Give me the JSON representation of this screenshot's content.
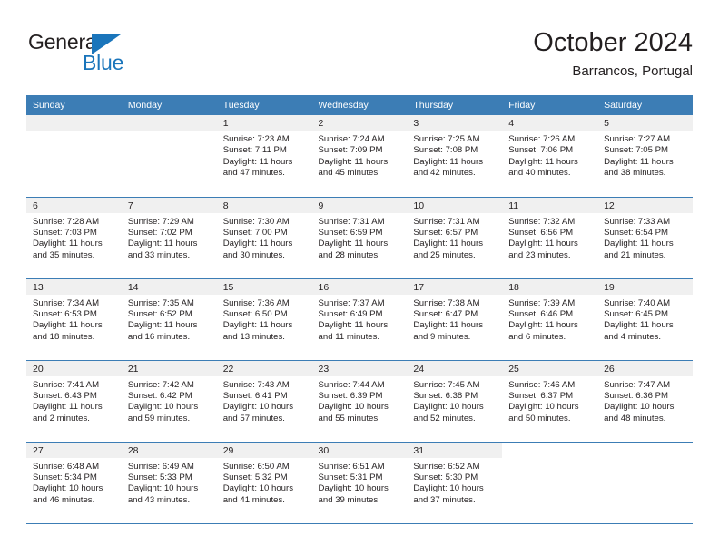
{
  "brand": {
    "name_top": "General",
    "name_bottom": "Blue",
    "mark": "blue-triangle-icon",
    "accent_color": "#1a75bb"
  },
  "header": {
    "title": "October 2024",
    "subtitle": "Barrancos, Portugal"
  },
  "theme": {
    "header_row_color": "#3c7db5",
    "daynum_band_color": "#f0f0f0",
    "text_color": "#231f20"
  },
  "weekdays": [
    "Sunday",
    "Monday",
    "Tuesday",
    "Wednesday",
    "Thursday",
    "Friday",
    "Saturday"
  ],
  "labels": {
    "sunrise_prefix": "Sunrise:",
    "sunset_prefix": "Sunset:",
    "daylight_prefix": "Daylight:"
  },
  "weeks": [
    [
      {
        "day": "",
        "sunrise": "",
        "sunset": "",
        "daylight_line1": "",
        "daylight_line2": ""
      },
      {
        "day": "",
        "sunrise": "",
        "sunset": "",
        "daylight_line1": "",
        "daylight_line2": ""
      },
      {
        "day": "1",
        "sunrise": "Sunrise: 7:23 AM",
        "sunset": "Sunset: 7:11 PM",
        "daylight_line1": "Daylight: 11 hours",
        "daylight_line2": "and 47 minutes."
      },
      {
        "day": "2",
        "sunrise": "Sunrise: 7:24 AM",
        "sunset": "Sunset: 7:09 PM",
        "daylight_line1": "Daylight: 11 hours",
        "daylight_line2": "and 45 minutes."
      },
      {
        "day": "3",
        "sunrise": "Sunrise: 7:25 AM",
        "sunset": "Sunset: 7:08 PM",
        "daylight_line1": "Daylight: 11 hours",
        "daylight_line2": "and 42 minutes."
      },
      {
        "day": "4",
        "sunrise": "Sunrise: 7:26 AM",
        "sunset": "Sunset: 7:06 PM",
        "daylight_line1": "Daylight: 11 hours",
        "daylight_line2": "and 40 minutes."
      },
      {
        "day": "5",
        "sunrise": "Sunrise: 7:27 AM",
        "sunset": "Sunset: 7:05 PM",
        "daylight_line1": "Daylight: 11 hours",
        "daylight_line2": "and 38 minutes."
      }
    ],
    [
      {
        "day": "6",
        "sunrise": "Sunrise: 7:28 AM",
        "sunset": "Sunset: 7:03 PM",
        "daylight_line1": "Daylight: 11 hours",
        "daylight_line2": "and 35 minutes."
      },
      {
        "day": "7",
        "sunrise": "Sunrise: 7:29 AM",
        "sunset": "Sunset: 7:02 PM",
        "daylight_line1": "Daylight: 11 hours",
        "daylight_line2": "and 33 minutes."
      },
      {
        "day": "8",
        "sunrise": "Sunrise: 7:30 AM",
        "sunset": "Sunset: 7:00 PM",
        "daylight_line1": "Daylight: 11 hours",
        "daylight_line2": "and 30 minutes."
      },
      {
        "day": "9",
        "sunrise": "Sunrise: 7:31 AM",
        "sunset": "Sunset: 6:59 PM",
        "daylight_line1": "Daylight: 11 hours",
        "daylight_line2": "and 28 minutes."
      },
      {
        "day": "10",
        "sunrise": "Sunrise: 7:31 AM",
        "sunset": "Sunset: 6:57 PM",
        "daylight_line1": "Daylight: 11 hours",
        "daylight_line2": "and 25 minutes."
      },
      {
        "day": "11",
        "sunrise": "Sunrise: 7:32 AM",
        "sunset": "Sunset: 6:56 PM",
        "daylight_line1": "Daylight: 11 hours",
        "daylight_line2": "and 23 minutes."
      },
      {
        "day": "12",
        "sunrise": "Sunrise: 7:33 AM",
        "sunset": "Sunset: 6:54 PM",
        "daylight_line1": "Daylight: 11 hours",
        "daylight_line2": "and 21 minutes."
      }
    ],
    [
      {
        "day": "13",
        "sunrise": "Sunrise: 7:34 AM",
        "sunset": "Sunset: 6:53 PM",
        "daylight_line1": "Daylight: 11 hours",
        "daylight_line2": "and 18 minutes."
      },
      {
        "day": "14",
        "sunrise": "Sunrise: 7:35 AM",
        "sunset": "Sunset: 6:52 PM",
        "daylight_line1": "Daylight: 11 hours",
        "daylight_line2": "and 16 minutes."
      },
      {
        "day": "15",
        "sunrise": "Sunrise: 7:36 AM",
        "sunset": "Sunset: 6:50 PM",
        "daylight_line1": "Daylight: 11 hours",
        "daylight_line2": "and 13 minutes."
      },
      {
        "day": "16",
        "sunrise": "Sunrise: 7:37 AM",
        "sunset": "Sunset: 6:49 PM",
        "daylight_line1": "Daylight: 11 hours",
        "daylight_line2": "and 11 minutes."
      },
      {
        "day": "17",
        "sunrise": "Sunrise: 7:38 AM",
        "sunset": "Sunset: 6:47 PM",
        "daylight_line1": "Daylight: 11 hours",
        "daylight_line2": "and 9 minutes."
      },
      {
        "day": "18",
        "sunrise": "Sunrise: 7:39 AM",
        "sunset": "Sunset: 6:46 PM",
        "daylight_line1": "Daylight: 11 hours",
        "daylight_line2": "and 6 minutes."
      },
      {
        "day": "19",
        "sunrise": "Sunrise: 7:40 AM",
        "sunset": "Sunset: 6:45 PM",
        "daylight_line1": "Daylight: 11 hours",
        "daylight_line2": "and 4 minutes."
      }
    ],
    [
      {
        "day": "20",
        "sunrise": "Sunrise: 7:41 AM",
        "sunset": "Sunset: 6:43 PM",
        "daylight_line1": "Daylight: 11 hours",
        "daylight_line2": "and 2 minutes."
      },
      {
        "day": "21",
        "sunrise": "Sunrise: 7:42 AM",
        "sunset": "Sunset: 6:42 PM",
        "daylight_line1": "Daylight: 10 hours",
        "daylight_line2": "and 59 minutes."
      },
      {
        "day": "22",
        "sunrise": "Sunrise: 7:43 AM",
        "sunset": "Sunset: 6:41 PM",
        "daylight_line1": "Daylight: 10 hours",
        "daylight_line2": "and 57 minutes."
      },
      {
        "day": "23",
        "sunrise": "Sunrise: 7:44 AM",
        "sunset": "Sunset: 6:39 PM",
        "daylight_line1": "Daylight: 10 hours",
        "daylight_line2": "and 55 minutes."
      },
      {
        "day": "24",
        "sunrise": "Sunrise: 7:45 AM",
        "sunset": "Sunset: 6:38 PM",
        "daylight_line1": "Daylight: 10 hours",
        "daylight_line2": "and 52 minutes."
      },
      {
        "day": "25",
        "sunrise": "Sunrise: 7:46 AM",
        "sunset": "Sunset: 6:37 PM",
        "daylight_line1": "Daylight: 10 hours",
        "daylight_line2": "and 50 minutes."
      },
      {
        "day": "26",
        "sunrise": "Sunrise: 7:47 AM",
        "sunset": "Sunset: 6:36 PM",
        "daylight_line1": "Daylight: 10 hours",
        "daylight_line2": "and 48 minutes."
      }
    ],
    [
      {
        "day": "27",
        "sunrise": "Sunrise: 6:48 AM",
        "sunset": "Sunset: 5:34 PM",
        "daylight_line1": "Daylight: 10 hours",
        "daylight_line2": "and 46 minutes."
      },
      {
        "day": "28",
        "sunrise": "Sunrise: 6:49 AM",
        "sunset": "Sunset: 5:33 PM",
        "daylight_line1": "Daylight: 10 hours",
        "daylight_line2": "and 43 minutes."
      },
      {
        "day": "29",
        "sunrise": "Sunrise: 6:50 AM",
        "sunset": "Sunset: 5:32 PM",
        "daylight_line1": "Daylight: 10 hours",
        "daylight_line2": "and 41 minutes."
      },
      {
        "day": "30",
        "sunrise": "Sunrise: 6:51 AM",
        "sunset": "Sunset: 5:31 PM",
        "daylight_line1": "Daylight: 10 hours",
        "daylight_line2": "and 39 minutes."
      },
      {
        "day": "31",
        "sunrise": "Sunrise: 6:52 AM",
        "sunset": "Sunset: 5:30 PM",
        "daylight_line1": "Daylight: 10 hours",
        "daylight_line2": "and 37 minutes."
      },
      {
        "day": "",
        "sunrise": "",
        "sunset": "",
        "daylight_line1": "",
        "daylight_line2": ""
      },
      {
        "day": "",
        "sunrise": "",
        "sunset": "",
        "daylight_line1": "",
        "daylight_line2": ""
      }
    ]
  ]
}
